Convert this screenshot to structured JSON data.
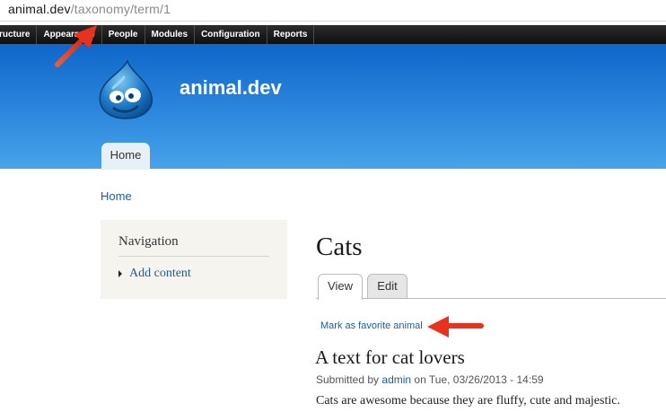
{
  "browser": {
    "url_host": "animal.dev",
    "url_path": "/taxonomy/term/1"
  },
  "toolbar": {
    "items": [
      "ructure",
      "Appearance",
      "People",
      "Modules",
      "Configuration",
      "Reports"
    ]
  },
  "header": {
    "site_name": "animal.dev",
    "logo_icon": "drupal-drop-logo",
    "tabs": [
      "Home"
    ]
  },
  "breadcrumb": {
    "home": "Home"
  },
  "sidebar": {
    "title": "Navigation",
    "links": [
      "Add content"
    ]
  },
  "main": {
    "page_title": "Cats",
    "tabs": [
      "View",
      "Edit"
    ],
    "favorite_link": "Mark as favorite animal",
    "node_title": "A text for cat lovers",
    "submitted_prefix": "Submitted by",
    "author": "admin",
    "submitted_suffix": "on Tue, 03/26/2013 - 14:59",
    "body": "Cats are awesome because they are fluffy, cute and majestic."
  },
  "annotations": {
    "arrow_color": "#e8321e",
    "arrow_icon": "red-annotation-arrow"
  },
  "colors": {
    "header_blue": "#0e67c9",
    "link_blue": "#1c5c9c",
    "toolbar_black": "#111111"
  }
}
